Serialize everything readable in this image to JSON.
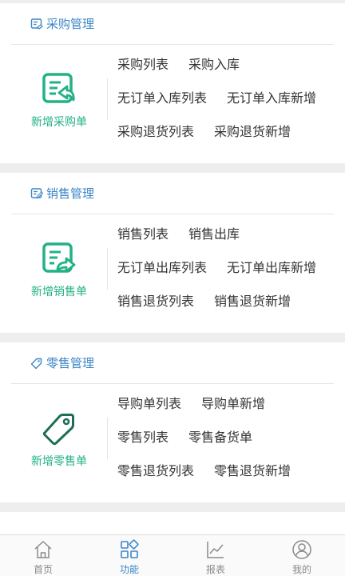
{
  "sections": [
    {
      "title": "采购管理",
      "new_label": "新增采购单",
      "rows": [
        [
          "采购列表",
          "采购入库"
        ],
        [
          "无订单入库列表",
          "无订单入库新增"
        ],
        [
          "采购退货列表",
          "采购退货新增"
        ]
      ]
    },
    {
      "title": "销售管理",
      "new_label": "新增销售单",
      "rows": [
        [
          "销售列表",
          "销售出库"
        ],
        [
          "无订单出库列表",
          "无订单出库新增"
        ],
        [
          "销售退货列表",
          "销售退货新增"
        ]
      ]
    },
    {
      "title": "零售管理",
      "new_label": "新增零售单",
      "rows": [
        [
          "导购单列表",
          "导购单新增"
        ],
        [
          "零售列表",
          "零售备货单"
        ],
        [
          "零售退货列表",
          "零售退货新增"
        ]
      ]
    }
  ],
  "tabbar": {
    "items": [
      {
        "label": "首页",
        "icon": "home-icon",
        "active": false
      },
      {
        "label": "功能",
        "icon": "grid-icon",
        "active": true
      },
      {
        "label": "报表",
        "icon": "chart-icon",
        "active": false
      },
      {
        "label": "我的",
        "icon": "user-icon",
        "active": false
      }
    ]
  },
  "colors": {
    "accent": "#3d86c7",
    "green": "#23b186",
    "text": "#333333",
    "tab_inactive": "#8a8a8a"
  }
}
